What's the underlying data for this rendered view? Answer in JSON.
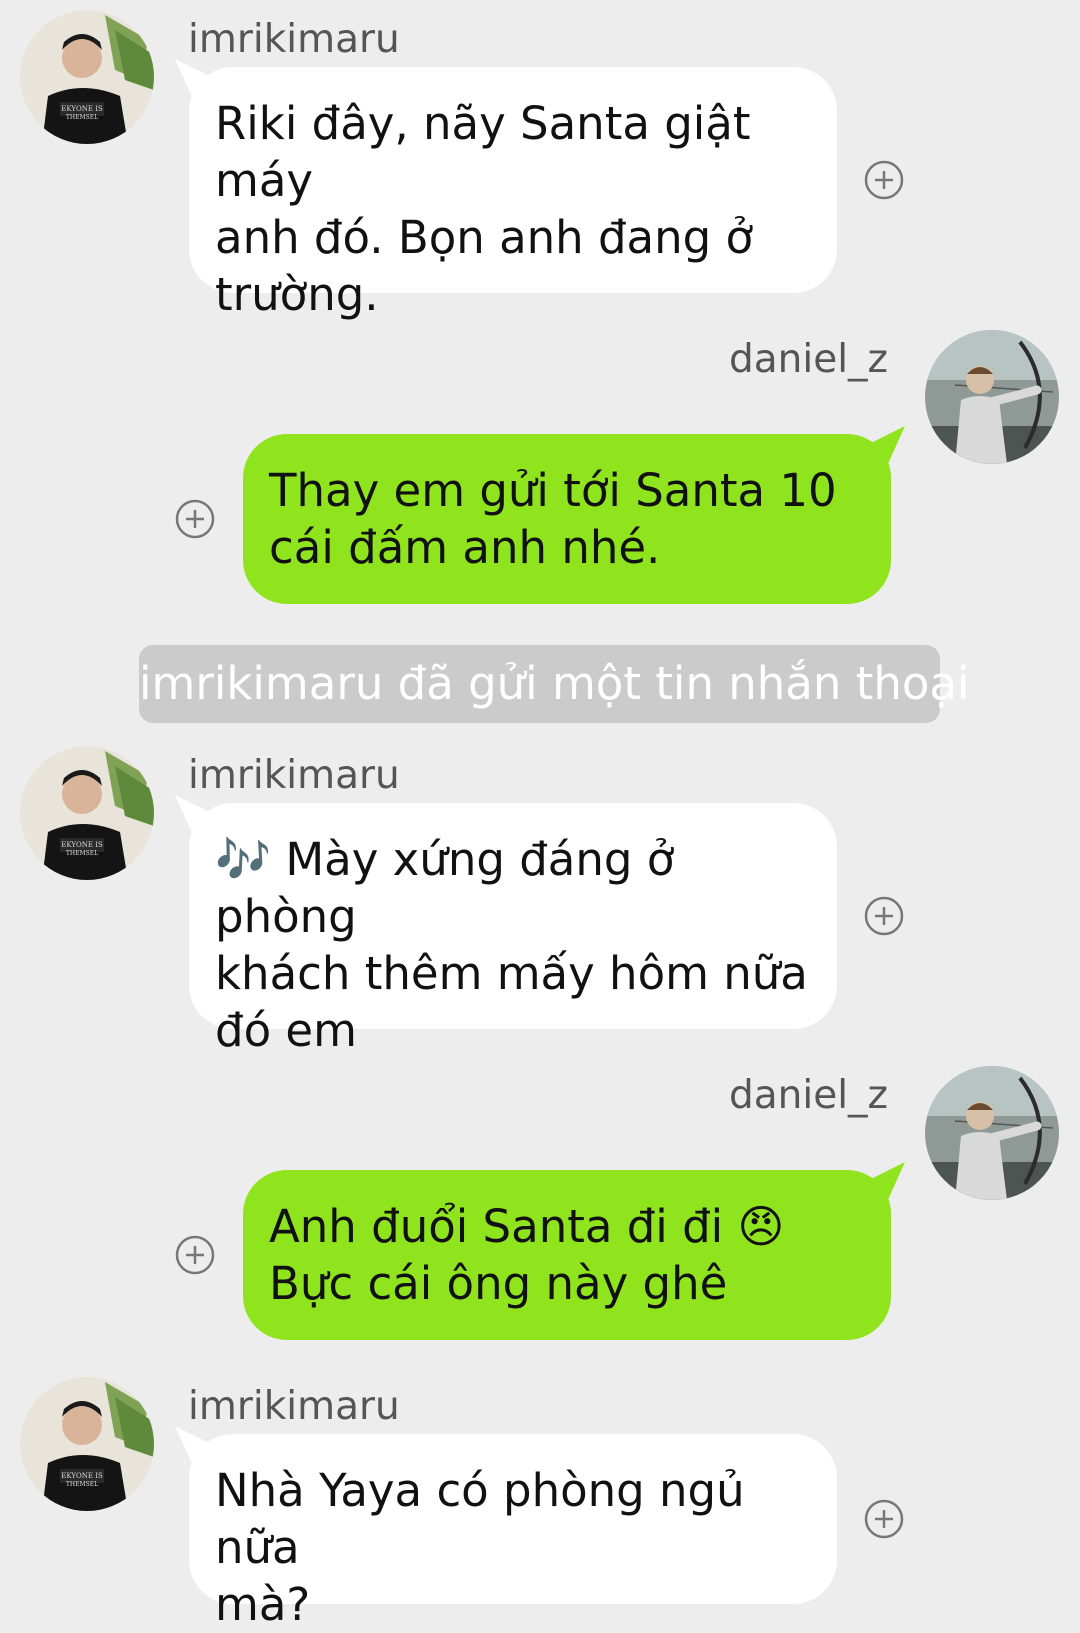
{
  "colors": {
    "background": "#ededed",
    "incoming_bubble": "#ffffff",
    "outgoing_bubble": "#8fe41e",
    "system_notice": "#cbcbcb"
  },
  "messages": [
    {
      "sender": "imrikimaru",
      "direction": "incoming",
      "text_lines": [
        "Riki đây, nãy Santa giật máy",
        "anh đó. Bọn anh đang ở",
        "trường."
      ]
    },
    {
      "sender": "daniel_z",
      "direction": "outgoing",
      "text_lines": [
        "Thay em gửi tới Santa 10",
        "cái đấm anh nhé."
      ]
    },
    {
      "sender": "imrikimaru",
      "direction": "incoming",
      "emoji": "🎶",
      "text_lines": [
        "Mày xứng đáng ở phòng",
        "khách thêm mấy hôm nữa",
        "đó em"
      ]
    },
    {
      "sender": "daniel_z",
      "direction": "outgoing",
      "emoji": "😠",
      "text_lines": [
        "Anh đuổi Santa đi đi",
        "Bực cái ông này ghê"
      ]
    },
    {
      "sender": "imrikimaru",
      "direction": "incoming",
      "text_lines": [
        "Nhà Yaya có phòng ngủ nữa",
        "mà?"
      ]
    }
  ],
  "system_notice": "imrikimaru đã gửi một tin nhắn thoại",
  "icons": {
    "add": "plus-circle-icon",
    "riki_avatar": "avatar-imrikimaru",
    "daniel_avatar": "avatar-daniel"
  }
}
